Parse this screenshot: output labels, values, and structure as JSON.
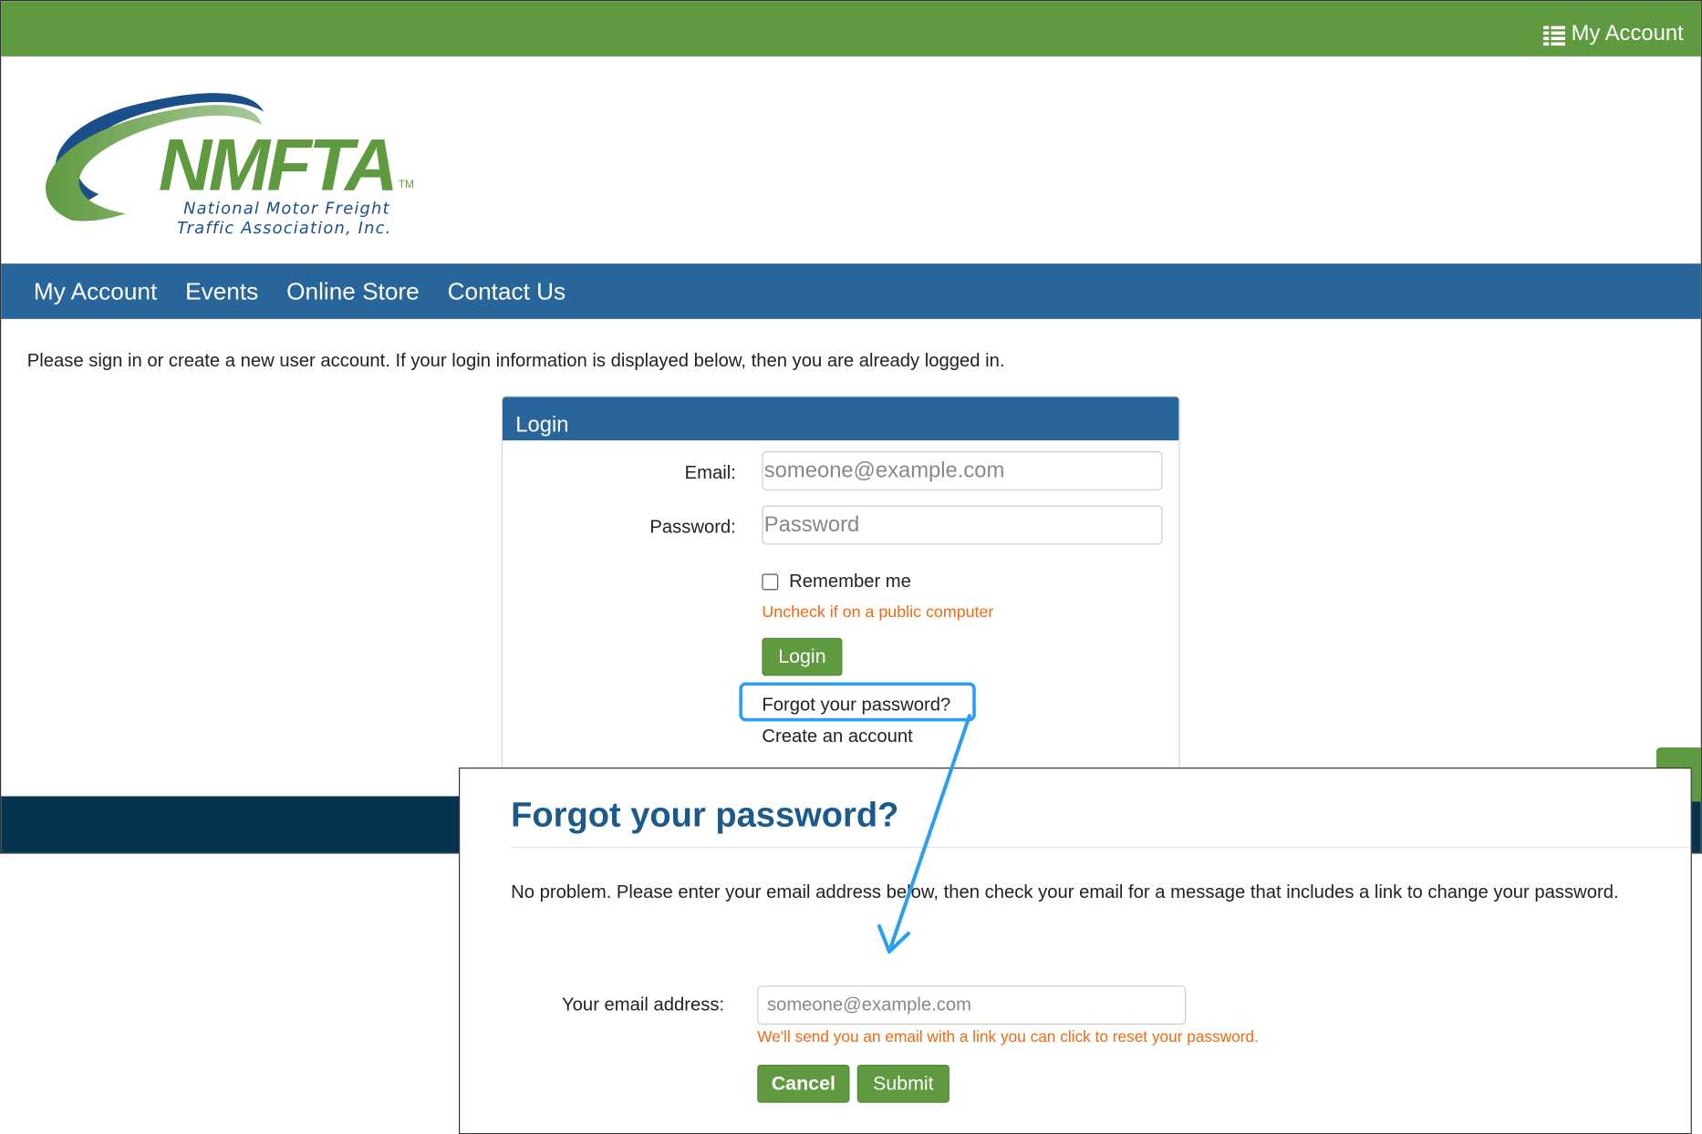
{
  "topbar": {
    "account_label": "My Account"
  },
  "logo": {
    "acronym": "NMFTA",
    "tm": "TM",
    "line1": "National Motor Freight",
    "line2": "Traffic Association, Inc."
  },
  "nav": {
    "items": [
      {
        "label": "My Account"
      },
      {
        "label": "Events"
      },
      {
        "label": "Online Store"
      },
      {
        "label": "Contact Us"
      }
    ]
  },
  "intro": "Please sign in or create a new user account. If your login information is displayed below, then you are already logged in.",
  "login": {
    "title": "Login",
    "email_label": "Email:",
    "email_placeholder": "someone@example.com",
    "password_label": "Password:",
    "password_placeholder": "Password",
    "remember_label": "Remember me",
    "remember_hint": "Uncheck if on a public computer",
    "login_button": "Login",
    "forgot_link": "Forgot your password?",
    "create_link": "Create an account"
  },
  "dialog": {
    "title": "Forgot your password?",
    "message": "No problem. Please enter your email address below, then check your email for a message that includes a link to change your password.",
    "email_label": "Your email address:",
    "email_placeholder": "someone@example.com",
    "hint": "We'll send you an email with a link you can click to reset your password.",
    "cancel_button": "Cancel",
    "submit_button": "Submit"
  },
  "colors": {
    "green": "#5f9a41",
    "blue_nav": "#28659a",
    "dark_footer": "#06334f",
    "orange_hint": "#ee6a12",
    "highlight": "#2a9df4",
    "title_blue": "#1b5a8a"
  }
}
